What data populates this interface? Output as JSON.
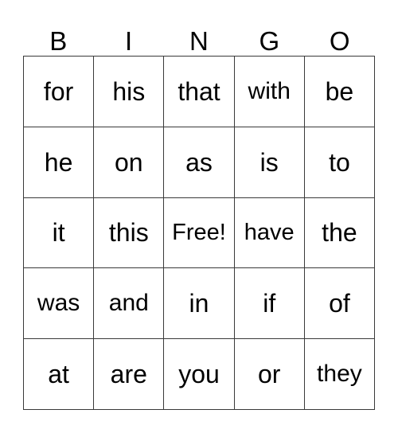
{
  "card": {
    "title": "BINGO",
    "headers": [
      "B",
      "I",
      "N",
      "G",
      "O"
    ],
    "free_space_label": "Free!",
    "colors": {
      "background": "#ffffff",
      "border": "#3a3a3a",
      "text": "#000000"
    },
    "rows": [
      {
        "cells": [
          "for",
          "his",
          "that",
          "with",
          "be"
        ]
      },
      {
        "cells": [
          "he",
          "on",
          "as",
          "is",
          "to"
        ]
      },
      {
        "cells": [
          "it",
          "this",
          "Free!",
          "have",
          "the"
        ]
      },
      {
        "cells": [
          "was",
          "and",
          "in",
          "if",
          "of"
        ]
      },
      {
        "cells": [
          "at",
          "are",
          "you",
          "or",
          "they"
        ]
      }
    ]
  }
}
